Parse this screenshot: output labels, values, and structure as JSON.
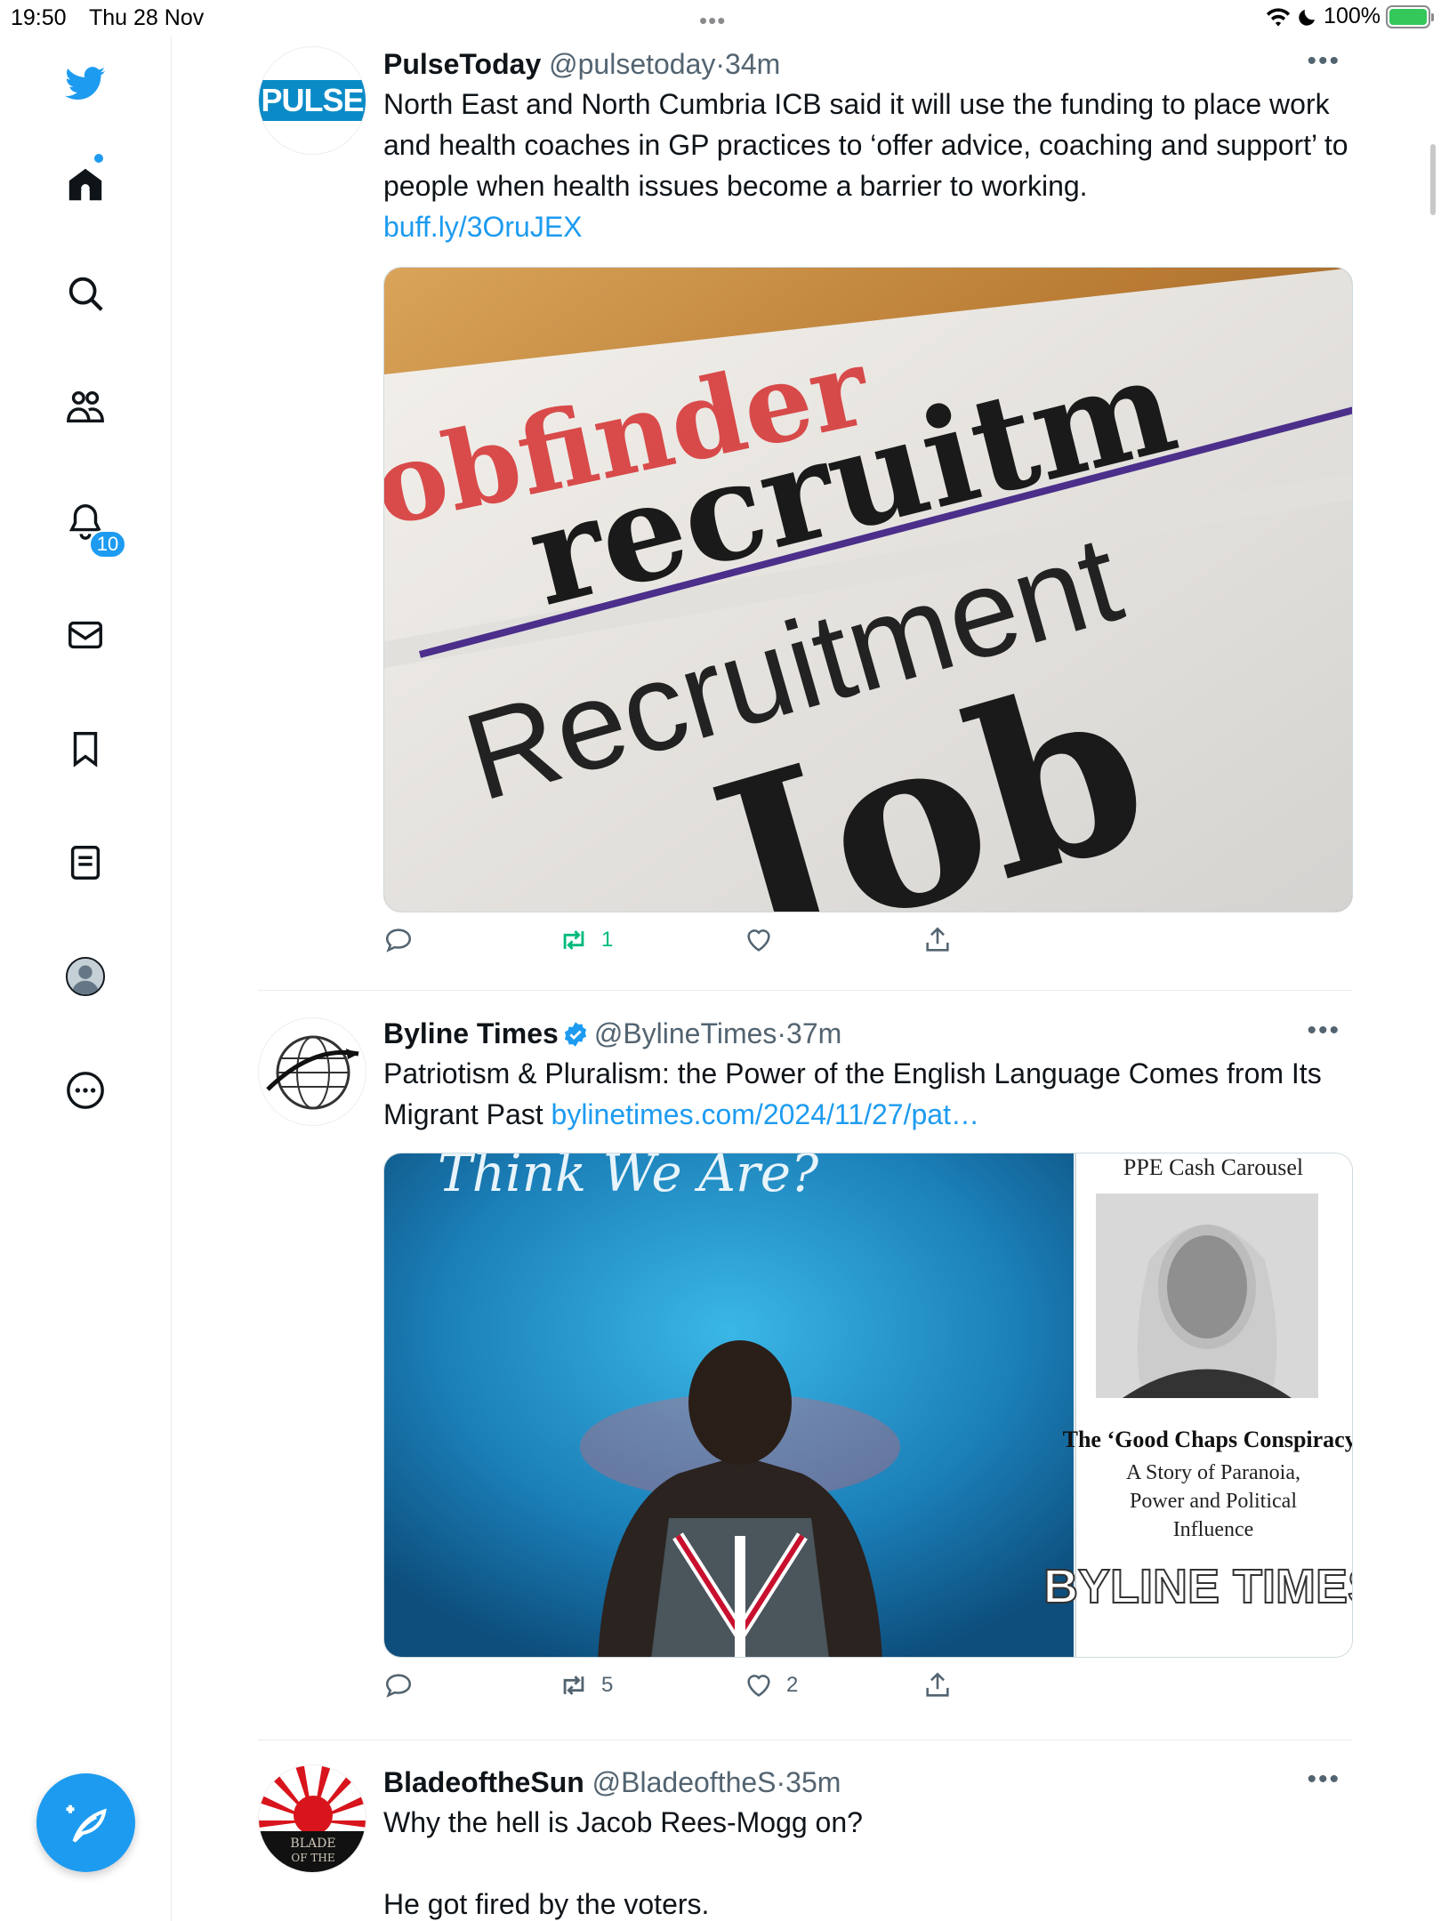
{
  "status_bar": {
    "time": "19:50",
    "date": "Thu 28 Nov",
    "battery": "100%",
    "battery_level": 1.0
  },
  "sidebar": {
    "items": [
      {
        "icon": "twitter-bird-icon"
      },
      {
        "icon": "home-icon"
      },
      {
        "icon": "search-icon"
      },
      {
        "icon": "communities-icon"
      },
      {
        "icon": "notifications-bell-icon"
      },
      {
        "icon": "messages-envelope-icon"
      },
      {
        "icon": "bookmark-icon"
      },
      {
        "icon": "lists-icon"
      },
      {
        "icon": "profile-avatar-icon"
      },
      {
        "icon": "more-options-icon"
      }
    ],
    "notifications_badge": "10",
    "compose_icon": "compose-feather-icon"
  },
  "tweets": [
    {
      "name": "PulseToday",
      "handle": "@pulsetoday",
      "sep": "·",
      "time": "34m",
      "avatar_text": "PULSE",
      "text": "North East and North Cumbria ICB said it will use the funding to place work and health coaches in GP practices to ‘offer advice, coaching and support’ to people when health issues become a barrier to working.",
      "link": "buff.ly/3OruJEX",
      "media": {
        "line1": "obfinder",
        "line2": "recruitm",
        "line3": "Recruitment",
        "line4": "Job"
      },
      "actions": {
        "reply": "",
        "retweet": "1",
        "like": "",
        "share": ""
      }
    },
    {
      "name": "Byline Times",
      "handle": "@BylineTimes",
      "sep": "·",
      "time": "37m",
      "verified": true,
      "text": "Patriotism & Pluralism: the Power of the English Language Comes from Its Migrant Past",
      "link": "bylinetimes.com/2024/11/27/pat…",
      "media": {
        "banner": "Think We Are?",
        "side_title": "PPE Cash Carousel",
        "side_headline": "The ‘Good Chaps Conspiracy’",
        "side_sub1": "A Story of Paranoia,",
        "side_sub2": "Power and Political",
        "side_sub3": "Influence",
        "logo": "BYLINE TIMES"
      },
      "actions": {
        "reply": "",
        "retweet": "5",
        "like": "2",
        "share": ""
      }
    },
    {
      "name": "BladeoftheSun",
      "handle": "@BladeoftheS",
      "sep": "·",
      "time": "35m",
      "avatar_text1": "BLADE",
      "avatar_text2": "OF THE",
      "text_line1": "Why the hell is Jacob Rees-Mogg on?",
      "text_line2": "He got fired by the voters."
    }
  ],
  "colors": {
    "accent": "#1d9bf0",
    "retweet_active": "#00ba7c",
    "secondary_text": "#536471"
  }
}
